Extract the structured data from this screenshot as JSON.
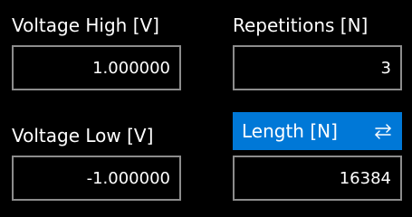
{
  "fields": {
    "voltage_high": {
      "label": "Voltage High [V]",
      "value": "1.000000"
    },
    "repetitions": {
      "label": "Repetitions [N]",
      "value": "3"
    },
    "voltage_low": {
      "label": "Voltage Low [V]",
      "value": "-1.000000"
    },
    "length": {
      "label": "Length [N]",
      "value": "16384",
      "toggle_icon": "swap-arrows-icon"
    }
  },
  "colors": {
    "background": "#000000",
    "field_border": "#8c8c8c",
    "accent": "#0078d7",
    "text": "#ffffff"
  }
}
